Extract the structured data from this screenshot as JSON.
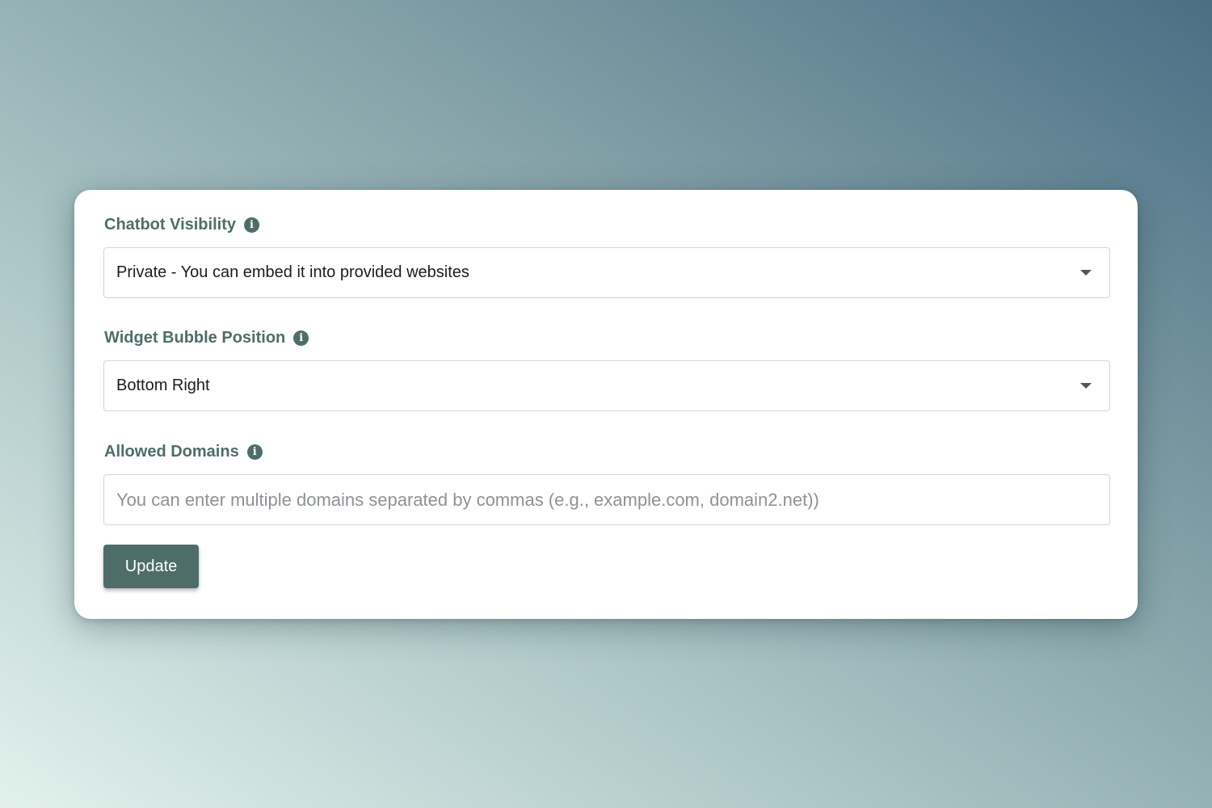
{
  "form": {
    "visibility": {
      "label": "Chatbot Visibility",
      "info_icon": "info-icon",
      "selected": "Private - You can embed it into provided websites"
    },
    "bubble_position": {
      "label": "Widget Bubble Position",
      "info_icon": "info-icon",
      "selected": "Bottom Right"
    },
    "allowed_domains": {
      "label": "Allowed Domains",
      "info_icon": "info-icon",
      "value": "",
      "placeholder": "You can enter multiple domains separated by commas (e.g., example.com, domain2.net))"
    },
    "update_button": {
      "label": "Update"
    }
  },
  "colors": {
    "accent": "#4e6d69",
    "label_text": "#4e6d69",
    "card_background": "#ffffff",
    "input_border": "#cfd6d8",
    "placeholder_text": "#8e9296"
  }
}
